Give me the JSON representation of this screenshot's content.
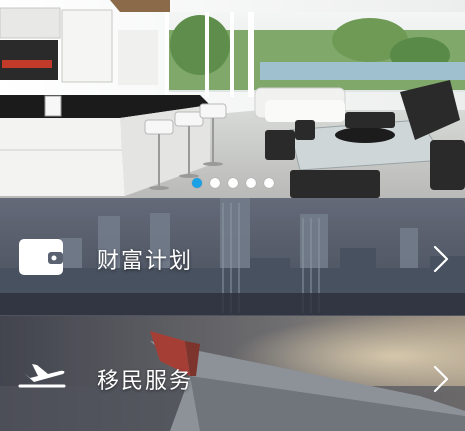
{
  "banner": {
    "slide_count": 5,
    "active_index": 0
  },
  "menu": {
    "items": [
      {
        "label": "财富计划",
        "icon": "wallet-icon",
        "action_icon": "chevron-right-icon"
      },
      {
        "label": "移民服务",
        "icon": "airplane-icon",
        "action_icon": "chevron-right-icon"
      }
    ]
  },
  "colors": {
    "dot_active": "#1aa1e6",
    "dot_inactive": "#ffffff",
    "label_text": "#ffffff"
  }
}
